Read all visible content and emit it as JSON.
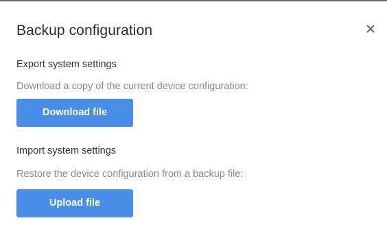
{
  "dialog": {
    "title": "Backup configuration",
    "close_icon": "close-icon"
  },
  "export": {
    "title": "Export system settings",
    "description": "Download a copy of the current device configuration:",
    "button_label": "Download file"
  },
  "import": {
    "title": "Import system settings",
    "description": "Restore the device configuration from a backup file:",
    "button_label": "Upload file"
  },
  "colors": {
    "button": "#4a8fe7",
    "button_text": "#ffffff",
    "title_text": "#2b2b2b",
    "muted_text": "#8a8a8a"
  }
}
